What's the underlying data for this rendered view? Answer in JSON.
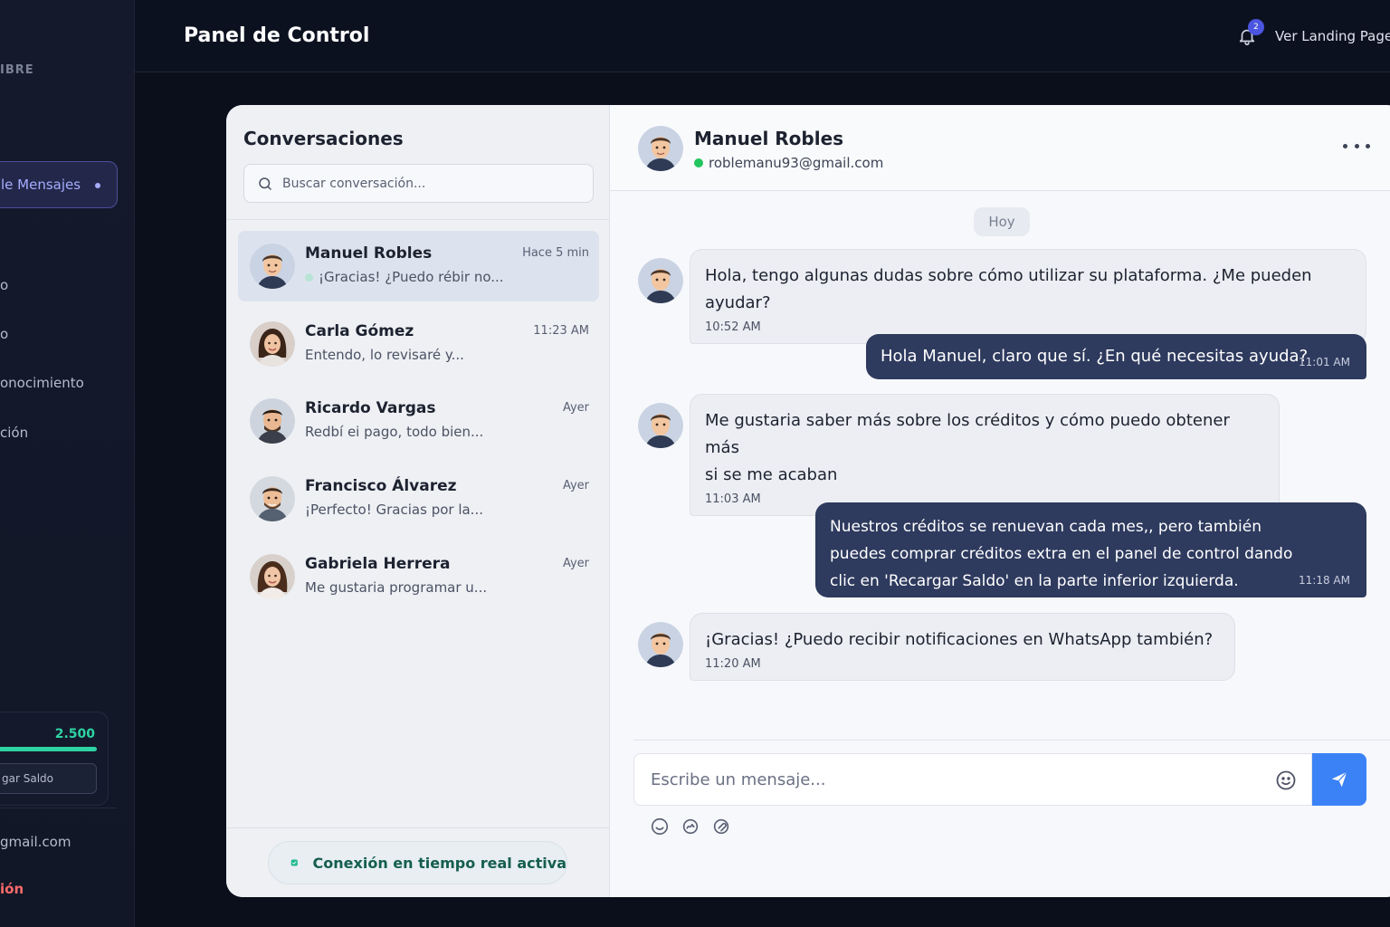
{
  "sidebar": {
    "top_label": "IBRE",
    "active_item": "le Mensajes",
    "items": [
      "o",
      "o",
      "onocimiento",
      "ción"
    ],
    "credits_value": "2.500",
    "credits_fill": 1.0,
    "recharge_label": "gar Saldo",
    "email": "gmail.com",
    "logout": "ión"
  },
  "header": {
    "title": "Panel de Control",
    "notification_count": "2",
    "landing_link": "Ver Landing Page"
  },
  "conversations": {
    "title": "Conversaciones",
    "search_placeholder": "Buscar conversación...",
    "items": [
      {
        "name": "Manuel Robles",
        "time": "Hace 5 min",
        "preview": "¡Gracias! ¿Puedo rébir no...",
        "active": true
      },
      {
        "name": "Carla Gómez",
        "time": "11:23 AM",
        "preview": "Entendo, lo revisaré y..."
      },
      {
        "name": "Ricardo Vargas",
        "time": "Ayer",
        "preview": "Redbí ei pago, todo bien..."
      },
      {
        "name": "Francisco Álvarez",
        "time": "Ayer",
        "preview": "¡Perfecto! Gracias por la..."
      },
      {
        "name": "Gabriela Herrera",
        "time": "Ayer",
        "preview": "Me gustaria programar u..."
      }
    ],
    "realtime_status": "Conexión en tiempo real activa"
  },
  "chat": {
    "contact_name": "Manuel Robles",
    "contact_email": "roblemanu93@gmail.com",
    "day_label": "Hoy",
    "messages": [
      {
        "direction": "in",
        "text": "Hola, tengo algunas dudas sobre cómo utilizar su plataforma. ¿Me pueden ayudar?",
        "time": "10:52 AM"
      },
      {
        "direction": "out",
        "text": "Hola Manuel, claro que sí. ¿En qué necesitas ayuda?",
        "time": "11:01 AM"
      },
      {
        "direction": "in",
        "text_line1": "Me gustaria saber más sobre los créditos y cómo puedo obtener más",
        "text_line2": "si se me acaban",
        "time": "11:03 AM"
      },
      {
        "direction": "out",
        "text_line1": "Nuestros créditos se renuevan cada mes,, pero también",
        "text_line2": "puedes comprar créditos extra en el panel de control dando",
        "text_line3": "clic en 'Recargar Saldo' en la parte inferior izquierda.",
        "time": "11:18 AM"
      },
      {
        "direction": "in",
        "text": "¡Gracias! ¿Puedo recibir notificaciones en WhatsApp también?",
        "time": "11:20 AM"
      }
    ],
    "input_placeholder": "Escribe un mensaje..."
  },
  "colors": {
    "accent": "#3b82f6",
    "outgoing_bubble": "#2e3a5e",
    "online": "#22c55e",
    "credits": "#2ed3a3",
    "logout": "#ff6b6b"
  },
  "icons": [
    "bell-icon",
    "search-icon",
    "more-options-icon",
    "emoji-icon",
    "send-icon",
    "check-shield-icon",
    "smile-icon",
    "sticker-icon",
    "attach-icon"
  ]
}
